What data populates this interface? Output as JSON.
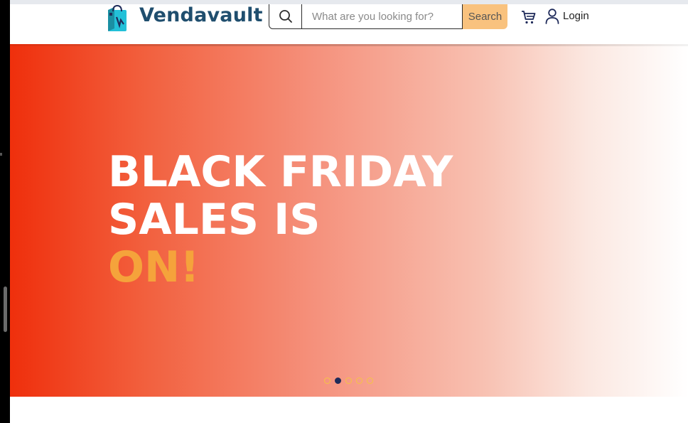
{
  "header": {
    "brand_name": "Vendavault",
    "search": {
      "placeholder": "What are you looking for?",
      "button_label": "Search"
    },
    "login_label": "Login",
    "icons": [
      "shopping-bag-logo-icon",
      "search-icon",
      "cart-icon",
      "user-icon"
    ]
  },
  "hero": {
    "line1": "BLACK FRIDAY",
    "line2": "SALES IS",
    "line3": "ON!",
    "slide_count": 5,
    "active_slide": 2
  },
  "colors": {
    "brand": "#1f4e6e",
    "accent": "#f5a33b",
    "search_button": "#f9c27e",
    "hero_start": "#ef2f0c",
    "dot_active": "#1f2b5a",
    "dot_border": "#f5c542"
  }
}
